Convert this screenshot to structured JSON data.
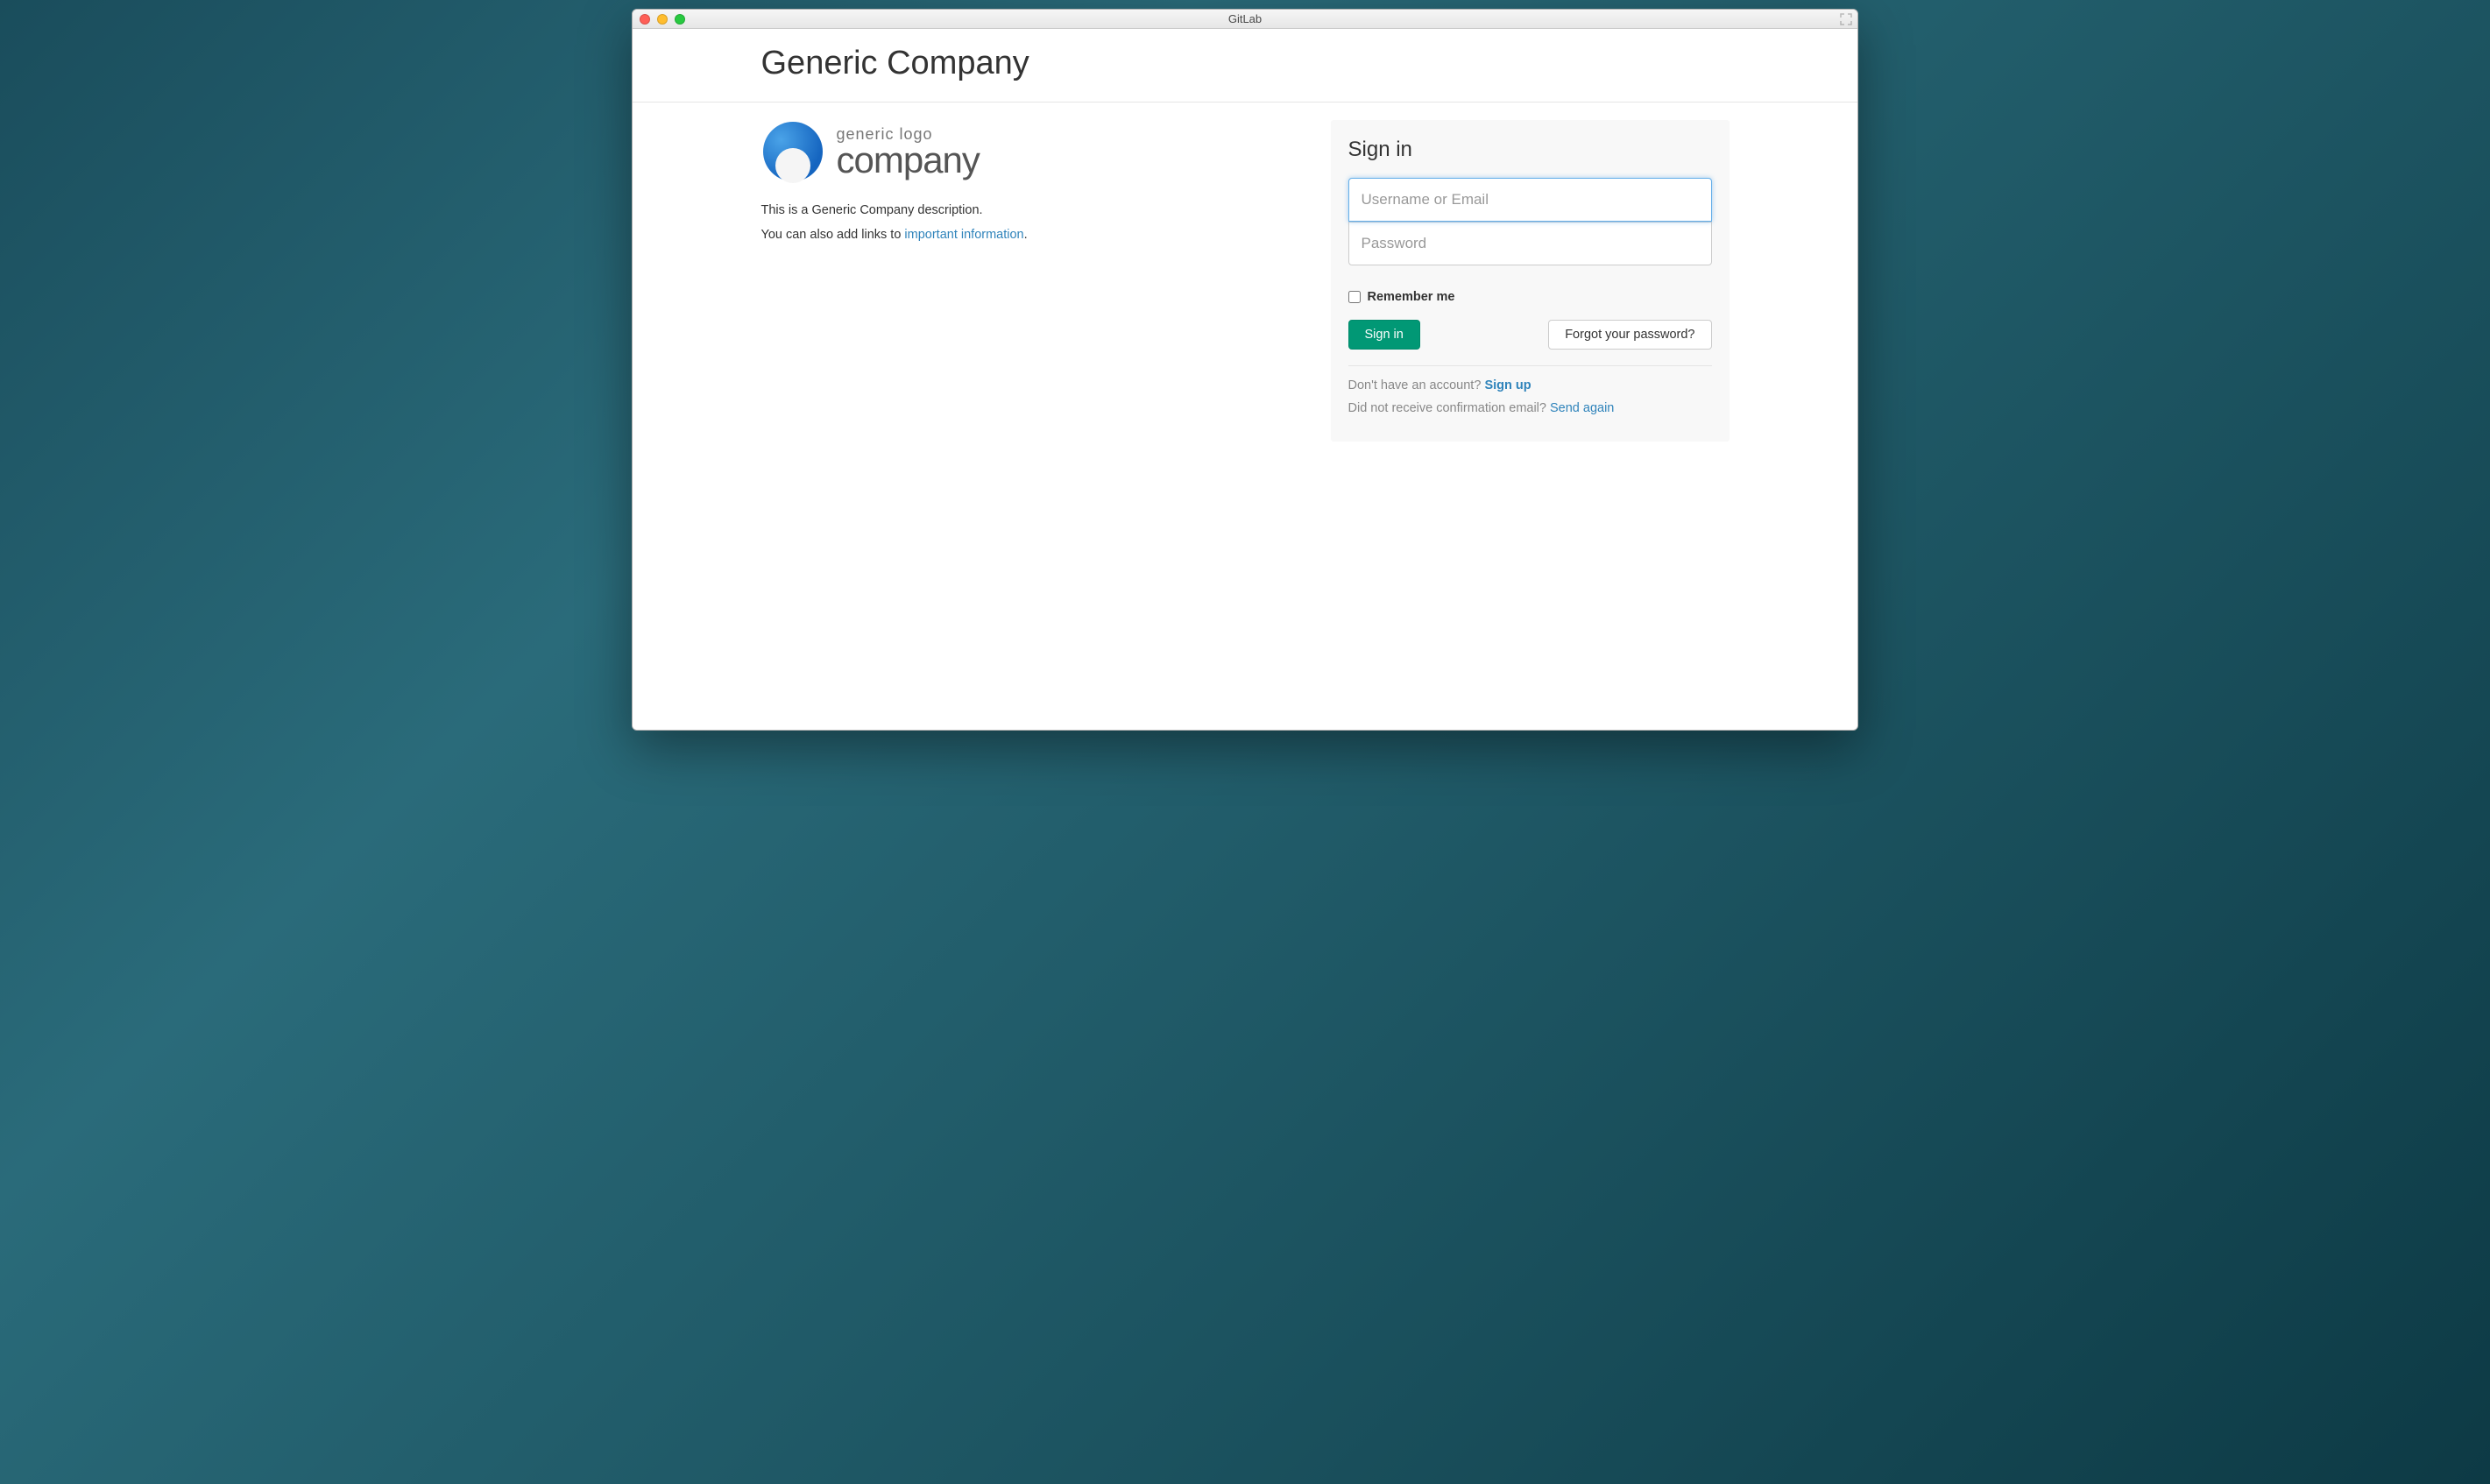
{
  "window": {
    "title": "GitLab"
  },
  "header": {
    "company_name": "Generic Company"
  },
  "branding": {
    "logo_subtitle": "generic logo",
    "logo_title": "company",
    "description_line1": "This is a Generic Company description.",
    "description_line2_prefix": "You can also add links to ",
    "description_link_text": "important information",
    "description_line2_suffix": "."
  },
  "signin": {
    "title": "Sign in",
    "username_placeholder": "Username or Email",
    "password_placeholder": "Password",
    "remember_label": "Remember me",
    "submit_label": "Sign in",
    "forgot_label": "Forgot your password?",
    "signup_prefix": "Don't have an account? ",
    "signup_link": "Sign up",
    "confirm_prefix": "Did not receive confirmation email? ",
    "confirm_link": "Send again"
  }
}
